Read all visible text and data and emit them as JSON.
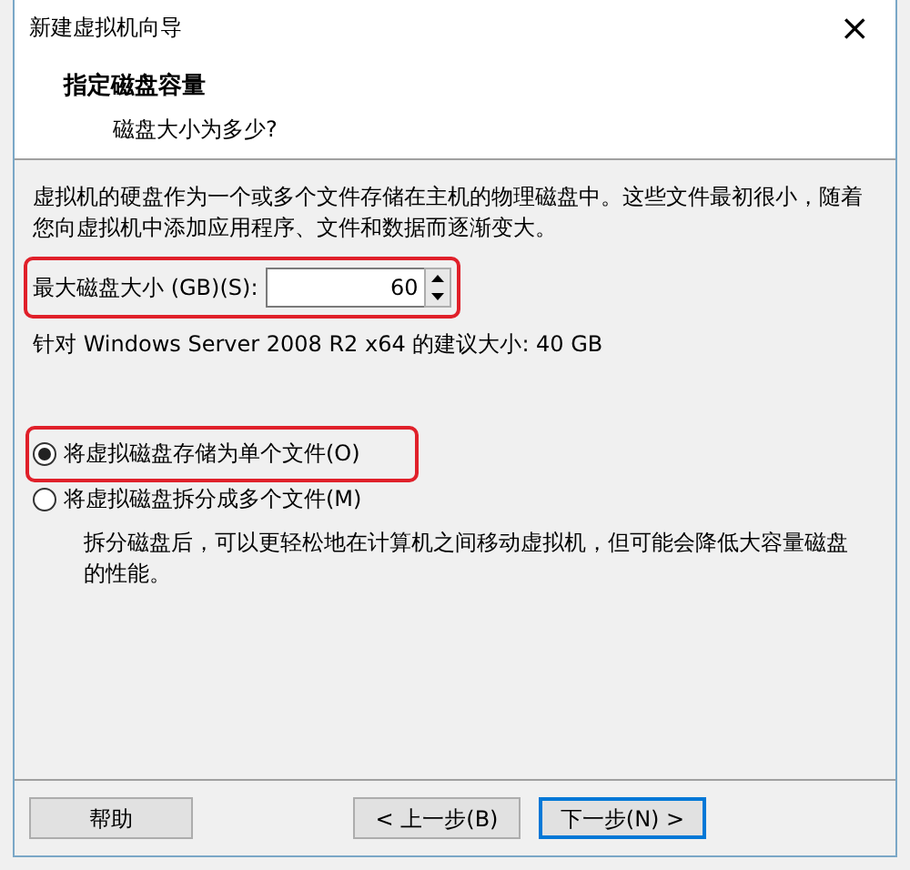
{
  "window": {
    "title": "新建虚拟机向导",
    "close_glyph": "×"
  },
  "header": {
    "title": "指定磁盘容量",
    "subtitle": "磁盘大小为多少?"
  },
  "description": "虚拟机的硬盘作为一个或多个文件存储在主机的物理磁盘中。这些文件最初很小，随着您向虚拟机中添加应用程序、文件和数据而逐渐变大。",
  "size_field": {
    "label": "最大磁盘大小 (GB)(S):",
    "value": "60",
    "highlighted": true
  },
  "recommendation": "针对 Windows Server 2008 R2 x64 的建议大小: 40 GB",
  "options": [
    {
      "label": "将虚拟磁盘存储为单个文件(O)",
      "selected": true,
      "highlighted": true
    },
    {
      "label": "将虚拟磁盘拆分成多个文件(M)",
      "selected": false,
      "highlighted": false,
      "note": "拆分磁盘后，可以更轻松地在计算机之间移动虚拟机，但可能会降低大容量磁盘的性能。"
    }
  ],
  "buttons": [
    {
      "label": "帮助",
      "kind": "help"
    },
    {
      "label": "< 上一步(B)",
      "kind": "back"
    },
    {
      "label": "下一步(N) >",
      "kind": "next"
    }
  ]
}
